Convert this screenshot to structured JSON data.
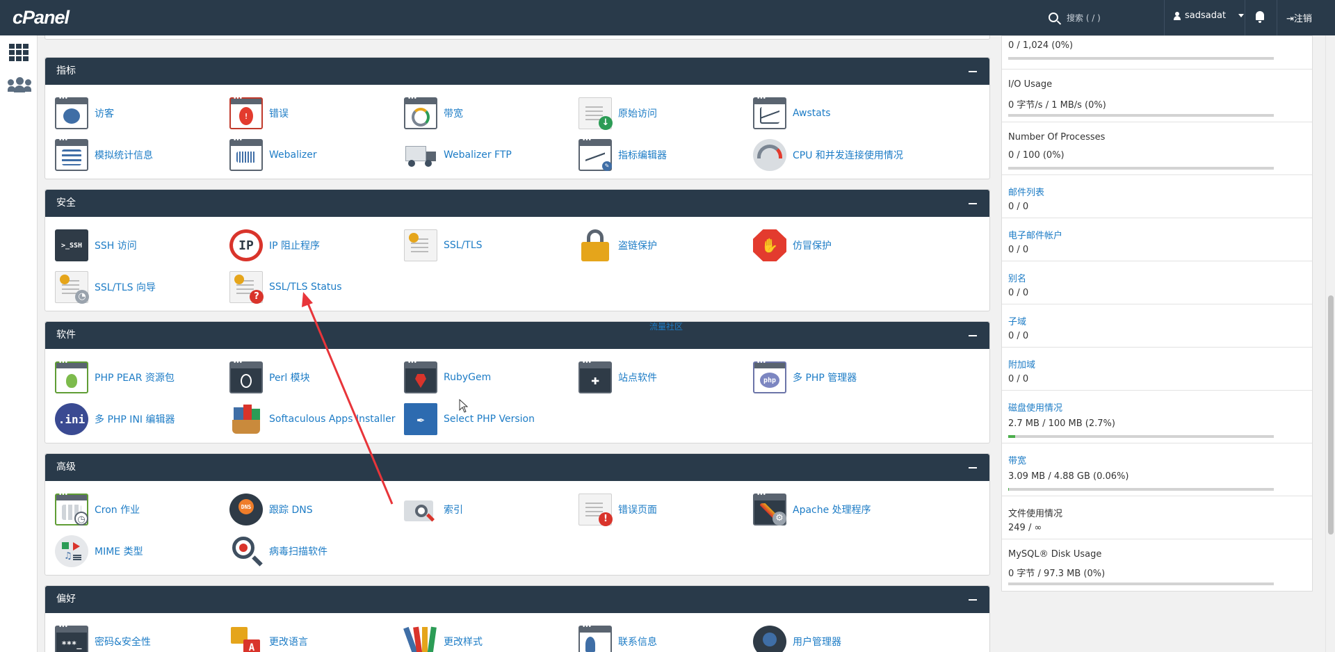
{
  "topbar": {
    "logo": "cPanel",
    "search_placeholder": "搜索 ( / )",
    "username": "sadsadat",
    "logout": "注销"
  },
  "floating_text": "流量社区",
  "sections": [
    {
      "title": "指标",
      "items": [
        {
          "label": "访客",
          "icon": "visitors-icon"
        },
        {
          "label": "错误",
          "icon": "errors-icon"
        },
        {
          "label": "带宽",
          "icon": "bandwidth-icon"
        },
        {
          "label": "原始访问",
          "icon": "raw-access-icon"
        },
        {
          "label": "Awstats",
          "icon": "awstats-icon"
        },
        {
          "label": "模拟统计信息",
          "icon": "analog-stats-icon"
        },
        {
          "label": "Webalizer",
          "icon": "webalizer-icon"
        },
        {
          "label": "Webalizer FTP",
          "icon": "webalizer-ftp-icon"
        },
        {
          "label": "指标编辑器",
          "icon": "metrics-editor-icon"
        },
        {
          "label": "CPU 和并发连接使用情况",
          "icon": "cpu-usage-icon"
        }
      ]
    },
    {
      "title": "安全",
      "items": [
        {
          "label": "SSH 访问",
          "icon": "ssh-icon"
        },
        {
          "label": "IP 阻止程序",
          "icon": "ip-blocker-icon"
        },
        {
          "label": "SSL/TLS",
          "icon": "ssl-tls-icon"
        },
        {
          "label": "盗链保护",
          "icon": "hotlink-lock-icon"
        },
        {
          "label": "仿冒保护",
          "icon": "leech-protect-icon"
        },
        {
          "label": "SSL/TLS 向导",
          "icon": "ssl-wizard-icon"
        },
        {
          "label": "SSL/TLS Status",
          "icon": "ssl-status-icon"
        }
      ]
    },
    {
      "title": "软件",
      "items": [
        {
          "label": "PHP PEAR 资源包",
          "icon": "php-pear-icon"
        },
        {
          "label": "Perl 模块",
          "icon": "perl-modules-icon"
        },
        {
          "label": "RubyGem",
          "icon": "rubygem-icon"
        },
        {
          "label": "站点软件",
          "icon": "site-software-icon"
        },
        {
          "label": "多 PHP 管理器",
          "icon": "multiphp-manager-icon"
        },
        {
          "label": "多 PHP INI 编辑器",
          "icon": "multiphp-ini-icon"
        },
        {
          "label": "Softaculous Apps Installer",
          "icon": "softaculous-icon"
        },
        {
          "label": "Select PHP Version",
          "icon": "select-php-icon"
        }
      ]
    },
    {
      "title": "高级",
      "items": [
        {
          "label": "Cron 作业",
          "icon": "cron-icon"
        },
        {
          "label": "跟踪 DNS",
          "icon": "track-dns-icon"
        },
        {
          "label": "索引",
          "icon": "indexes-icon"
        },
        {
          "label": "错误页面",
          "icon": "error-pages-icon"
        },
        {
          "label": "Apache 处理程序",
          "icon": "apache-handlers-icon"
        },
        {
          "label": "MIME 类型",
          "icon": "mime-types-icon"
        },
        {
          "label": "病毒扫描软件",
          "icon": "virus-scanner-icon"
        }
      ]
    },
    {
      "title": "偏好",
      "items": [
        {
          "label": "密码&安全性",
          "icon": "password-icon"
        },
        {
          "label": "更改语言",
          "icon": "language-icon"
        },
        {
          "label": "更改样式",
          "icon": "style-icon"
        },
        {
          "label": "联系信息",
          "icon": "contact-icon"
        },
        {
          "label": "用户管理器",
          "icon": "user-manager-icon"
        }
      ]
    }
  ],
  "stats": [
    {
      "name": "",
      "value": "0 / 1,024   (0%)",
      "pct": 0,
      "bar": true,
      "link": false
    },
    {
      "name": "I/O Usage",
      "value": "0 字节/s / 1 MB/s   (0%)",
      "pct": 0,
      "bar": true,
      "link": false
    },
    {
      "name": "Number Of Processes",
      "value": "0 / 100   (0%)",
      "pct": 0,
      "bar": true,
      "link": false
    },
    {
      "name": "邮件列表",
      "value": "0 / 0",
      "bar": false,
      "link": true
    },
    {
      "name": "电子邮件帐户",
      "value": "0 / 0",
      "bar": false,
      "link": true
    },
    {
      "name": "别名",
      "value": "0 / 0",
      "bar": false,
      "link": true
    },
    {
      "name": "子域",
      "value": "0 / 0",
      "bar": false,
      "link": true
    },
    {
      "name": "附加域",
      "value": "0 / 0",
      "bar": false,
      "link": true
    },
    {
      "name": "磁盘使用情况",
      "value": "2.7 MB / 100 MB   (2.7%)",
      "pct": 2.7,
      "bar": true,
      "link": true
    },
    {
      "name": "带宽",
      "value": "3.09 MB / 4.88 GB   (0.06%)",
      "pct": 0.06,
      "bar": true,
      "link": true
    },
    {
      "name": "文件使用情况",
      "value": "249 / ∞",
      "bar": false,
      "link": false
    },
    {
      "name": "MySQL® Disk Usage",
      "value": "0 字节 / 97.3 MB   (0%)",
      "pct": 0,
      "bar": true,
      "link": false
    }
  ],
  "colors": {
    "header": "#293a4a",
    "link": "#1d7cc6",
    "bar_fill": "#4cae4c",
    "annotation_arrow": "#e8353a"
  }
}
